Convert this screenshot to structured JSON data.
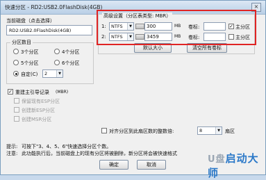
{
  "window": {
    "title": "快速分区 - RD2:USB2.0FlashDisk(4GB)",
    "close_glyph": "×"
  },
  "disk": {
    "label": "当前磁盘（点击选择）",
    "value": "RD2:USB2.0FlashDisk(4GB)"
  },
  "partition_count": {
    "label": "分区数目",
    "options": [
      "3个分区",
      "4个分区",
      "5个分区",
      "6个分区"
    ],
    "custom_label": "自定(C)",
    "custom_value": "2"
  },
  "mbr": {
    "rebuild_label": "重建主引导记录",
    "rebuild_suffix": "(MBR)",
    "rebuild_checked": "✓",
    "options": [
      "保留现有ESP分区",
      "创建新ESP分区",
      "创建MSR分区"
    ]
  },
  "advanced": {
    "title": "高级设置（分区表类型: MBR）",
    "rows": [
      {
        "num": "1:",
        "fs": "NTFS",
        "size": "300",
        "unit": "MB",
        "vol_label": "卷标:",
        "primary_label": "主分区",
        "checked": "✓"
      },
      {
        "num": "2:",
        "fs": "NTFS",
        "size": "3459",
        "unit": "MB",
        "vol_label": "卷标:",
        "primary_label": "主分区",
        "checked": ""
      }
    ],
    "default_size_btn": "默认大小",
    "clear_labels_btn": "清空所有卷标"
  },
  "align": {
    "label": "对齐分区到此扇区数的整数倍:",
    "value": "8",
    "unit": "扇区"
  },
  "hints": {
    "line1_prefix": "提示:",
    "line1": "可按下\"3、4、5、6\"快速选择分区个数。",
    "line2_prefix": "注意:",
    "line2": "此功能执行后，当前磁盘上的现有分区将被删除，新分区将会被快速格式"
  },
  "buttons": {
    "ok": "确定",
    "cancel": "取消"
  },
  "watermark": {
    "prefix": "U盘",
    "text": "启动大师"
  }
}
